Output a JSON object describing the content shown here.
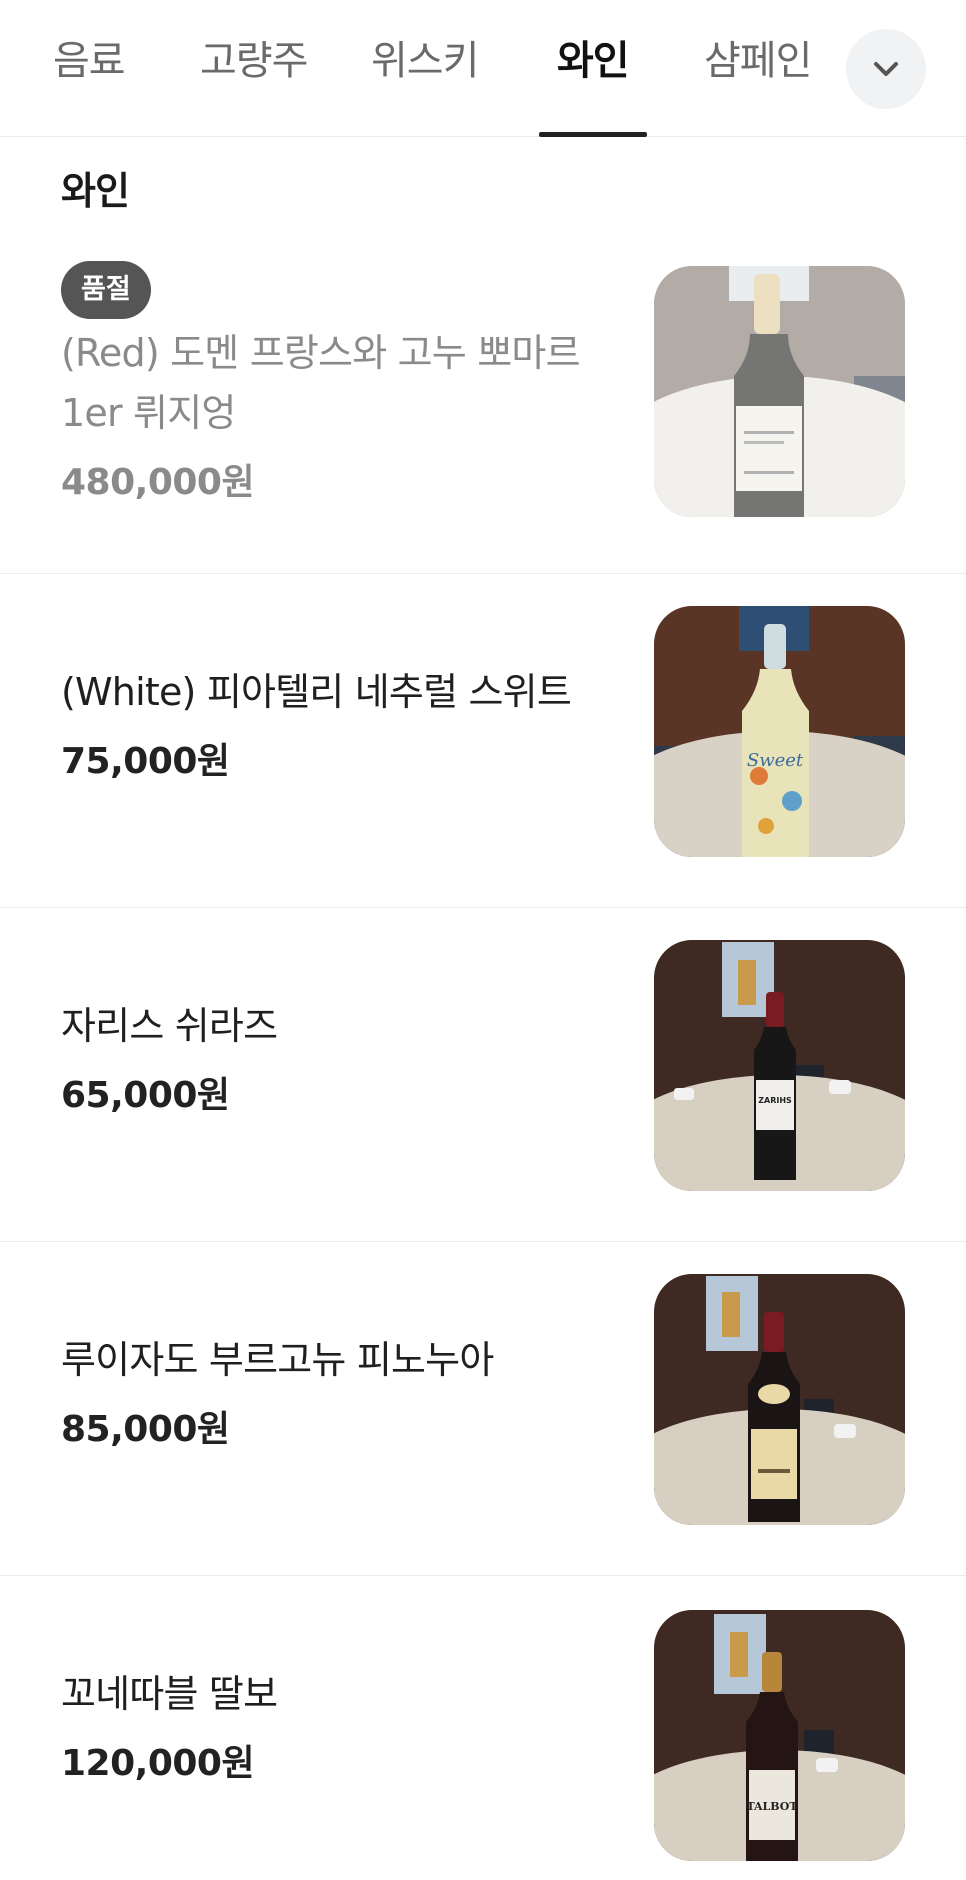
{
  "tabs": [
    {
      "label": "음료",
      "active": false
    },
    {
      "label": "고량주",
      "active": false
    },
    {
      "label": "위스키",
      "active": false
    },
    {
      "label": "와인",
      "active": true
    },
    {
      "label": "샴페인",
      "active": false
    }
  ],
  "more_icon": "chevron-down-icon",
  "section": {
    "title": "와인"
  },
  "items": [
    {
      "badge": "품절",
      "name": "(Red) 도멘 프랑스와 고누 뽀마르 1er 뤼지엉",
      "price": "480,000원",
      "sold_out": true,
      "image": "wine-bottle-photo"
    },
    {
      "name": "(White) 피아텔리 네추럴 스위트",
      "price": "75,000원",
      "sold_out": false,
      "image": "wine-bottle-photo"
    },
    {
      "name": "자리스 쉬라즈",
      "price": "65,000원",
      "sold_out": false,
      "image": "wine-bottle-photo"
    },
    {
      "name": "루이자도 부르고뉴 피노누아",
      "price": "85,000원",
      "sold_out": false,
      "image": "wine-bottle-photo"
    },
    {
      "name": "꼬네따블 딸보",
      "price": "120,000원",
      "sold_out": false,
      "image": "wine-bottle-photo"
    }
  ],
  "colors": {
    "active_tab": "#111111",
    "inactive_tab": "#6a6a6a",
    "badge_bg": "#555555",
    "divider": "#ececec"
  }
}
